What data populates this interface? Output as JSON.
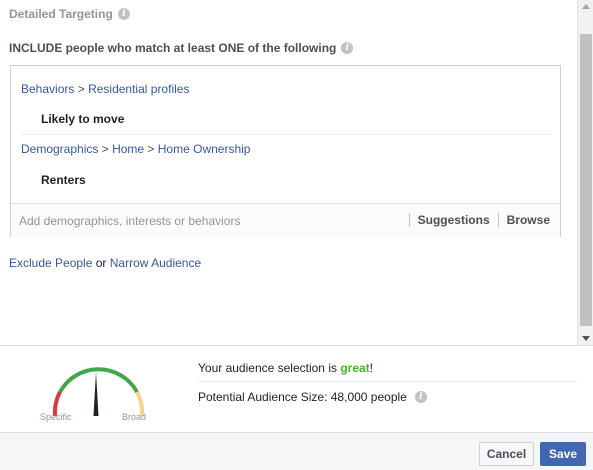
{
  "detailed_targeting": {
    "title": "Detailed Targeting",
    "include_label": "INCLUDE people who match at least ONE of the following",
    "groups": [
      {
        "breadcrumb": [
          "Behaviors",
          "Residential profiles"
        ],
        "item": "Likely to move"
      },
      {
        "breadcrumb": [
          "Demographics",
          "Home",
          "Home Ownership"
        ],
        "item": "Renters"
      }
    ],
    "breadcrumb_separator": ">",
    "add_placeholder": "Add demographics, interests or behaviors",
    "suggestions_label": "Suggestions",
    "browse_label": "Browse",
    "exclude_link": "Exclude People",
    "or_text": "or",
    "narrow_link": "Narrow Audience"
  },
  "audience": {
    "selection_prefix": "Your audience selection is ",
    "selection_value": "great",
    "selection_suffix": "!",
    "size_text": "Potential Audience Size: 48,000 people",
    "gauge_specific": "Specific",
    "gauge_broad": "Broad",
    "gauge_level": 0.47,
    "colors": {
      "great": "#42b72a",
      "gauge_red": "#d63c3c",
      "gauge_green": "#42a64a",
      "gauge_yellow": "#f7d089"
    }
  },
  "footer": {
    "cancel_label": "Cancel",
    "save_label": "Save",
    "save_color": "#4267b2"
  },
  "icons": {
    "info": "info-icon"
  }
}
